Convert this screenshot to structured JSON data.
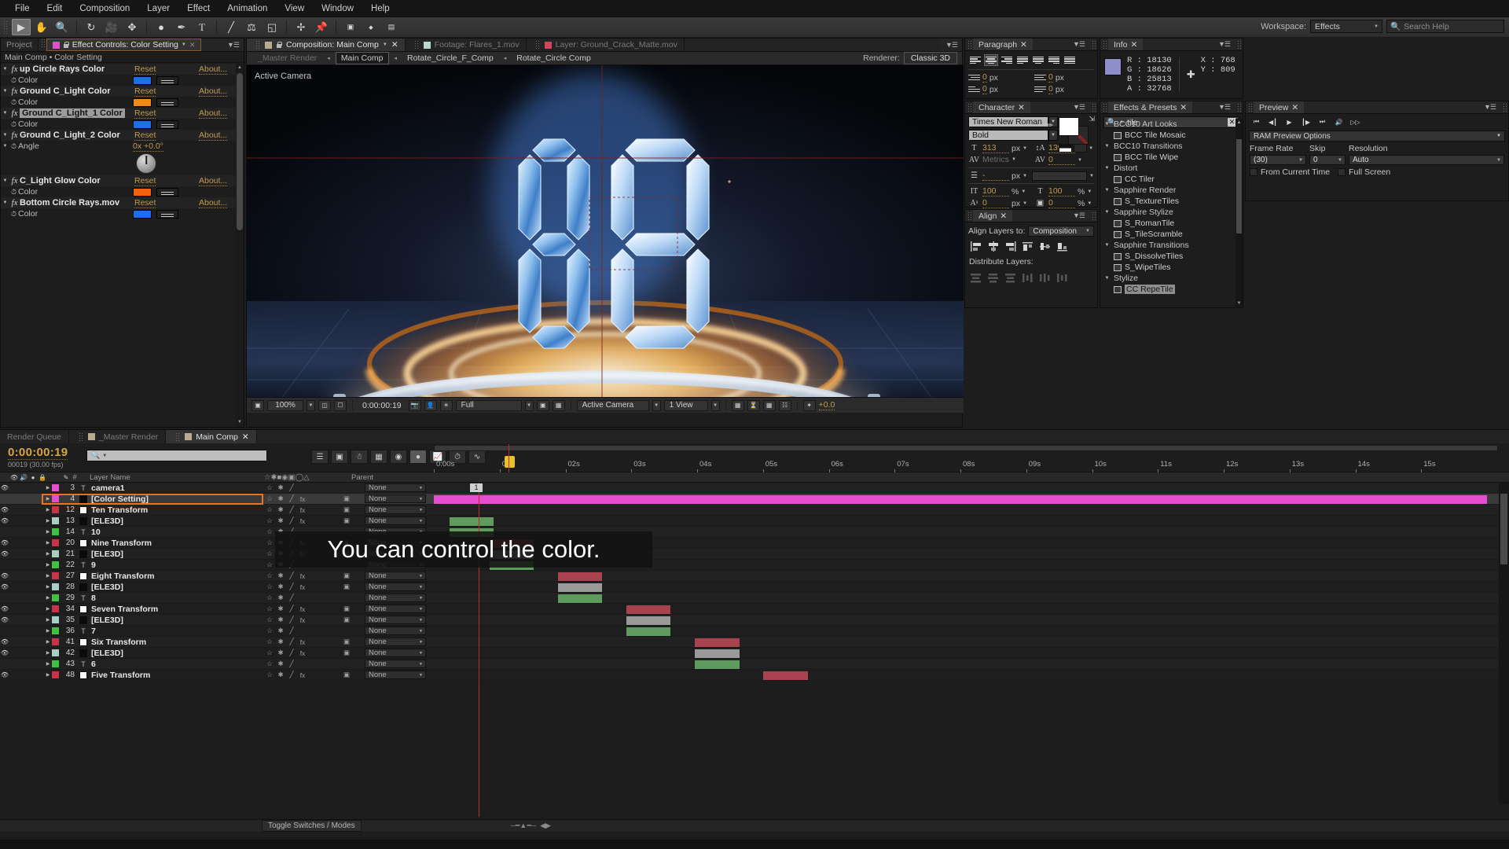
{
  "menubar": [
    "File",
    "Edit",
    "Composition",
    "Layer",
    "Effect",
    "Animation",
    "View",
    "Window",
    "Help"
  ],
  "toolbar": {
    "workspace_label": "Workspace:",
    "workspace_value": "Effects",
    "search_placeholder": "Search Help",
    "tools": [
      "selection-tool",
      "hand-tool",
      "zoom-tool",
      "rotation-tool",
      "camera-tool",
      "pan-behind-tool",
      "shape-tool",
      "pen-tool",
      "type-tool",
      "brush-tool",
      "clone-stamp-tool",
      "eraser-tool",
      "roto-brush-tool",
      "puppet-pin-tool"
    ]
  },
  "effect_controls": {
    "tab_project": "Project",
    "tab_title": "Effect Controls: Color Setting",
    "breadcrumb": "Main Comp • Color Setting",
    "reset_label": "Reset",
    "about_label": "About...",
    "effects": [
      {
        "name": "up Circle Rays Color",
        "prop": "Color",
        "swatch": "#1b6fe8",
        "type": "color",
        "highlight": false
      },
      {
        "name": "Ground C_Light Color",
        "prop": "Color",
        "swatch": "#f08a18",
        "type": "color",
        "highlight": false
      },
      {
        "name": "Ground C_Light_1 Color",
        "prop": "Color",
        "swatch": "#1b6fe8",
        "type": "color",
        "highlight": true
      },
      {
        "name": "Ground C_Light_2 Color",
        "prop": "Angle",
        "value": "0x +0.0°",
        "type": "angle",
        "highlight": false
      },
      {
        "name": "C_Light Glow Color",
        "prop": "Color",
        "swatch": "#f0620f",
        "type": "color",
        "highlight": false
      },
      {
        "name": "Bottom Circle Rays.mov",
        "prop": "Color",
        "swatch": "#1b6fe8",
        "type": "color",
        "highlight": false
      }
    ]
  },
  "viewer": {
    "tabs": [
      {
        "label": "Composition: Main Comp",
        "swatch": "#b9ab8f",
        "active": true
      },
      {
        "label": "Footage: Flares_1.mov",
        "swatch": "#b5d8d0",
        "active": false
      },
      {
        "label": "Layer: Ground_Crack_Matte.mov",
        "swatch": "#d1455c",
        "active": false
      }
    ],
    "breadcrumbs": [
      "_Master Render",
      "Main Comp",
      "Rotate_Circle_F_Comp",
      "Rotate_Circle Comp"
    ],
    "active_crumb": "Main Comp",
    "renderer_label": "Renderer:",
    "renderer_value": "Classic 3D",
    "camera_label": "Active Camera",
    "bottom": {
      "zoom": "100%",
      "time": "0:00:00:19",
      "resolution": "Full",
      "view_camera": "Active Camera",
      "views": "1 View",
      "exposure": "+0.0"
    }
  },
  "info": {
    "title": "Info",
    "r": "R : 18130",
    "g": "G : 18626",
    "b": "B : 25813",
    "a": "A : 32768",
    "x": "X : 768",
    "y": "Y : 809",
    "swatch": "#8e8ec9"
  },
  "paragraph": {
    "title": "Paragraph",
    "indent_left": "0",
    "indent_right": "0",
    "indent_first": "0",
    "space_before": "0",
    "space_after": "0",
    "unit": "px"
  },
  "character": {
    "title": "Character",
    "font_family": "Times New Roman",
    "font_style": "Bold",
    "font_size": "313",
    "leading": "139",
    "kerning": "Metrics",
    "tracking": "0",
    "stroke_width": "-",
    "vertical_scale": "100",
    "horizontal_scale": "100",
    "baseline_shift": "0",
    "tsume": "0",
    "unit_px": "px",
    "unit_pct": "%",
    "style_buttons": [
      "faux-bold",
      "faux-italic",
      "all-caps",
      "small-caps",
      "superscript",
      "subscript"
    ]
  },
  "align": {
    "title": "Align",
    "align_layers_label": "Align Layers to:",
    "align_target": "Composition",
    "distribute_label": "Distribute Layers:"
  },
  "preview": {
    "title": "Preview",
    "ram_options": "RAM Preview Options",
    "frame_rate_label": "Frame Rate",
    "frame_rate_value": "(30)",
    "skip_label": "Skip",
    "skip_value": "0",
    "resolution_label": "Resolution",
    "resolution_value": "Auto",
    "from_current_time": "From Current Time",
    "full_screen": "Full Screen"
  },
  "effects_presets": {
    "title": "Effects & Presets",
    "search_value": "tile",
    "groups": [
      {
        "category": "BCC10 Art Looks",
        "items": [
          "BCC Tile Mosaic"
        ]
      },
      {
        "category": "BCC10 Transitions",
        "items": [
          "BCC Tile Wipe"
        ]
      },
      {
        "category": "Distort",
        "items": [
          "CC Tiler"
        ]
      },
      {
        "category": "Sapphire Render",
        "items": [
          "S_TextureTiles"
        ]
      },
      {
        "category": "Sapphire Stylize",
        "items": [
          "S_RomanTile",
          "S_TileScramble"
        ]
      },
      {
        "category": "Sapphire Transitions",
        "items": [
          "S_DissolveTiles",
          "S_WipeTiles"
        ]
      },
      {
        "category": "Stylize",
        "items": [
          "CC RepeTile"
        ]
      }
    ],
    "selected_item": "CC RepeTile"
  },
  "timeline": {
    "tabs": [
      {
        "label": "Render Queue",
        "active": false,
        "swatch": null
      },
      {
        "label": "_Master Render",
        "active": false,
        "swatch": "#b9ab8f"
      },
      {
        "label": "Main Comp",
        "active": true,
        "swatch": "#b9ab8f"
      }
    ],
    "timecode": "0:00:00:19",
    "frame_info": "00019 (30.00 fps)",
    "column_header_num": "#",
    "column_header_name": "Layer Name",
    "column_header_parent": "Parent",
    "toggle_switches_modes": "Toggle Switches / Modes",
    "ruler_labels": [
      "0:00s",
      "01s",
      "02s",
      "03s",
      "04s",
      "05s",
      "06s",
      "07s",
      "08s",
      "09s",
      "10s",
      "11s",
      "12s",
      "13s",
      "14s",
      "15s"
    ],
    "parent_none": "None",
    "marker_label": "1",
    "subtitle": "You can control the color.",
    "layers": [
      {
        "num": "3",
        "name": "camera1",
        "swatch": "#e24fc8",
        "box": null,
        "eye": true,
        "selected": false,
        "bar": null
      },
      {
        "num": "4",
        "name": "[Color Setting]",
        "swatch": "#e24fc8",
        "box": "#0b0b0b",
        "eye": false,
        "selected": true,
        "bar": {
          "start": 0,
          "width": 100,
          "color": "#e34fd0"
        }
      },
      {
        "num": "12",
        "name": "Ten Transform",
        "swatch": "#c7344a",
        "box": "#ffffff",
        "eye": true,
        "selected": false,
        "bar": null
      },
      {
        "num": "13",
        "name": "[ELE3D]",
        "swatch": "#a9cec6",
        "box": "#0b0b0b",
        "eye": true,
        "selected": false,
        "bar": {
          "start": 1.5,
          "width": 4.2,
          "color": "#5f9b5f"
        }
      },
      {
        "num": "14",
        "name": "10",
        "swatch": "#43c043",
        "box": null,
        "eye": false,
        "selected": false,
        "bar": {
          "start": 1.5,
          "width": 4.2,
          "color": "#5f9b5f"
        }
      },
      {
        "num": "20",
        "name": "Nine Transform",
        "swatch": "#c7344a",
        "box": "#ffffff",
        "eye": true,
        "selected": false,
        "bar": {
          "start": 5.3,
          "width": 4.2,
          "color": "#a8424f"
        }
      },
      {
        "num": "21",
        "name": "[ELE3D]",
        "swatch": "#a9cec6",
        "box": "#0b0b0b",
        "eye": true,
        "selected": false,
        "bar": {
          "start": 5.3,
          "width": 4.2,
          "color": "#9a9a9a"
        }
      },
      {
        "num": "22",
        "name": "9",
        "swatch": "#43c043",
        "box": null,
        "eye": false,
        "selected": false,
        "bar": {
          "start": 5.3,
          "width": 4.2,
          "color": "#5f9b5f"
        }
      },
      {
        "num": "27",
        "name": "Eight Transform",
        "swatch": "#c7344a",
        "box": "#ffffff",
        "eye": true,
        "selected": false,
        "bar": {
          "start": 11.8,
          "width": 4.2,
          "color": "#a8424f"
        }
      },
      {
        "num": "28",
        "name": "[ELE3D]",
        "swatch": "#a9cec6",
        "box": "#0b0b0b",
        "eye": true,
        "selected": false,
        "bar": {
          "start": 11.8,
          "width": 4.2,
          "color": "#9a9a9a"
        }
      },
      {
        "num": "29",
        "name": "8",
        "swatch": "#43c043",
        "box": null,
        "eye": false,
        "selected": false,
        "bar": {
          "start": 11.8,
          "width": 4.2,
          "color": "#5f9b5f"
        }
      },
      {
        "num": "34",
        "name": "Seven Transform",
        "swatch": "#c7344a",
        "box": "#ffffff",
        "eye": true,
        "selected": false,
        "bar": {
          "start": 18.3,
          "width": 4.2,
          "color": "#a8424f"
        }
      },
      {
        "num": "35",
        "name": "[ELE3D]",
        "swatch": "#a9cec6",
        "box": "#0b0b0b",
        "eye": true,
        "selected": false,
        "bar": {
          "start": 18.3,
          "width": 4.2,
          "color": "#9a9a9a"
        }
      },
      {
        "num": "36",
        "name": "7",
        "swatch": "#43c043",
        "box": null,
        "eye": false,
        "selected": false,
        "bar": {
          "start": 18.3,
          "width": 4.2,
          "color": "#5f9b5f"
        }
      },
      {
        "num": "41",
        "name": "Six Transform",
        "swatch": "#c7344a",
        "box": "#ffffff",
        "eye": true,
        "selected": false,
        "bar": {
          "start": 24.8,
          "width": 4.2,
          "color": "#a8424f"
        }
      },
      {
        "num": "42",
        "name": "[ELE3D]",
        "swatch": "#a9cec6",
        "box": "#0b0b0b",
        "eye": true,
        "selected": false,
        "bar": {
          "start": 24.8,
          "width": 4.2,
          "color": "#9a9a9a"
        }
      },
      {
        "num": "43",
        "name": "6",
        "swatch": "#43c043",
        "box": null,
        "eye": false,
        "selected": false,
        "bar": {
          "start": 24.8,
          "width": 4.2,
          "color": "#5f9b5f"
        }
      },
      {
        "num": "48",
        "name": "Five Transform",
        "swatch": "#c7344a",
        "box": "#ffffff",
        "eye": true,
        "selected": false,
        "bar": {
          "start": 31.3,
          "width": 4.2,
          "color": "#a8424f"
        }
      }
    ]
  }
}
